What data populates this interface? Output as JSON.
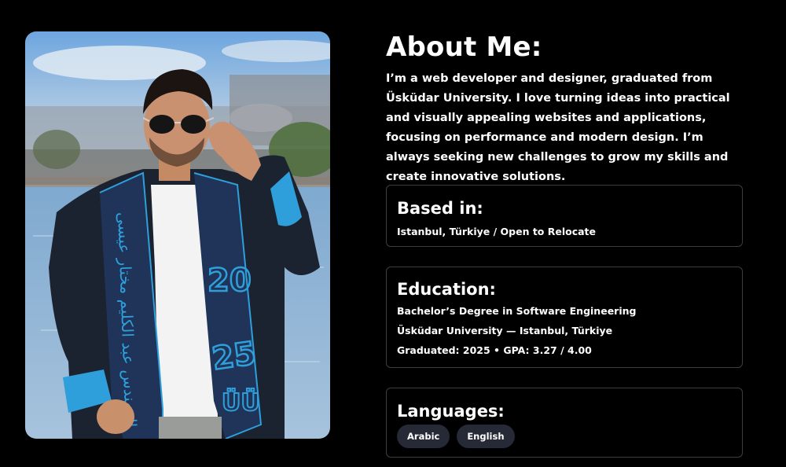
{
  "about": {
    "title": "About Me:",
    "description": "I’m a web developer and designer, graduated from Üsküdar University. I love turning ideas into practical and visually appealing websites and applications, focusing on performance and modern design. I’m always seeking new challenges to grow my skills and create innovative solutions."
  },
  "photo": {
    "stole_year_top": "20",
    "stole_year_bottom": "25",
    "stole_initials": "ÜÜ",
    "stole_arabic": "المهندس عبد الكليم مختار عيسى"
  },
  "based": {
    "title": "Based in:",
    "line": "Istanbul, Türkiye / Open to Relocate"
  },
  "education": {
    "title": "Education:",
    "degree": "Bachelor’s Degree in Software Engineering",
    "school": "Üsküdar University — Istanbul, Türkiye",
    "graduation": "Graduated: 2025 • GPA: 3.27 / 4.00"
  },
  "languages": {
    "title": "Languages:",
    "items": [
      "Arabic",
      "English"
    ]
  },
  "colors": {
    "background": "#000000",
    "text": "#ffffff",
    "card_border": "#3a3d44",
    "chip_background": "#252a36",
    "stole_accent": "#2f9fdc"
  }
}
